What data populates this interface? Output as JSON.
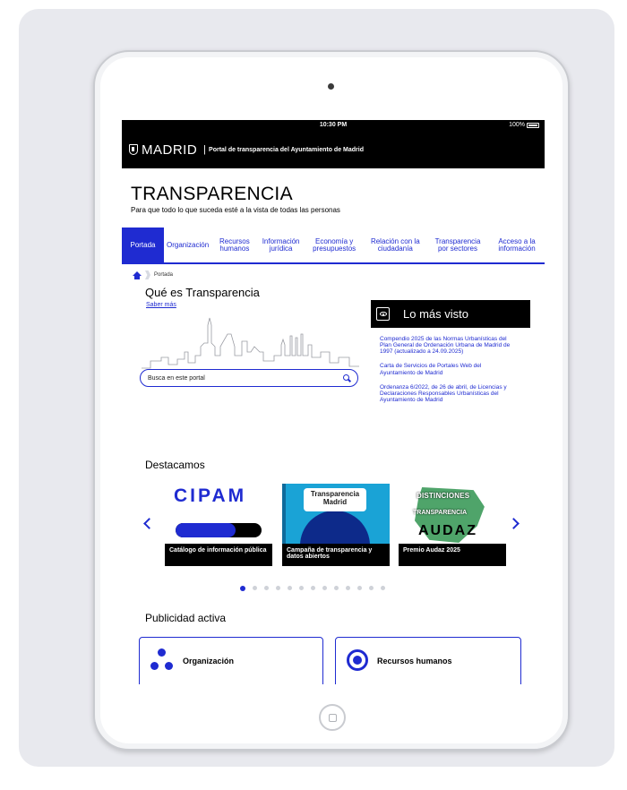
{
  "status": {
    "time": "10:30 PM",
    "battery": "100%"
  },
  "header": {
    "logo_word": "MADRID",
    "separator": "|",
    "subtitle": "Portal de transparencia del Ayuntamiento de Madrid"
  },
  "brand": {
    "title": "TRANSPARENCIA",
    "tagline": "Para que todo lo que suceda esté a la vista de todas las personas"
  },
  "nav": {
    "items": [
      {
        "label": "Portada",
        "active": true
      },
      {
        "label": "Organización",
        "active": false
      },
      {
        "label": "Recursos humanos",
        "active": false
      },
      {
        "label": "Información jurídica",
        "active": false
      },
      {
        "label": "Economía y presupuestos",
        "active": false
      },
      {
        "label": "Relación con la ciudadanía",
        "active": false
      },
      {
        "label": "Transparencia por sectores",
        "active": false
      },
      {
        "label": "Acceso a la información",
        "active": false
      }
    ]
  },
  "breadcrumb": {
    "current": "Portada"
  },
  "intro": {
    "title": "Qué es Transparencia",
    "link": "Saber más"
  },
  "search": {
    "placeholder": "Busca en este portal"
  },
  "mas_visto": {
    "title": "Lo más visto",
    "links": [
      "Compendio 2025 de las Normas Urbanísticas del Plan General de Ordenación Urbana de Madrid de 1997 (actualizado a 24.09.2025)",
      "Carta de Servicios de Portales Web del Ayuntamiento de Madrid",
      "Ordenanza 6/2022, de 26 de abril, de Licencias y Declaraciones Responsables Urbanísticas del Ayuntamiento de Madrid"
    ]
  },
  "destacamos": {
    "title": "Destacamos",
    "slides": [
      {
        "caption": "Catálogo de información pública",
        "logo_text": "CIPAM",
        "bar_progress": 0.7
      },
      {
        "caption": "Campaña de transparencia y datos abiertos",
        "pill_text": "Transparencia Madrid"
      },
      {
        "caption": "Premio Audaz 2025",
        "img_text_1": "DISTINCIONES",
        "img_text_2": "TRANSPARENCIA",
        "img_text_3": "AUDAZ"
      }
    ],
    "dot_count": 13,
    "active_dot": 0
  },
  "publicidad": {
    "title": "Publicidad activa",
    "cards": [
      {
        "label": "Organización",
        "icon": "people-icon"
      },
      {
        "label": "Recursos humanos",
        "icon": "radio-icon"
      }
    ]
  },
  "colors": {
    "accent": "#1f2bd1",
    "header_bg": "#000000",
    "backdrop": "#e8e9ee"
  }
}
